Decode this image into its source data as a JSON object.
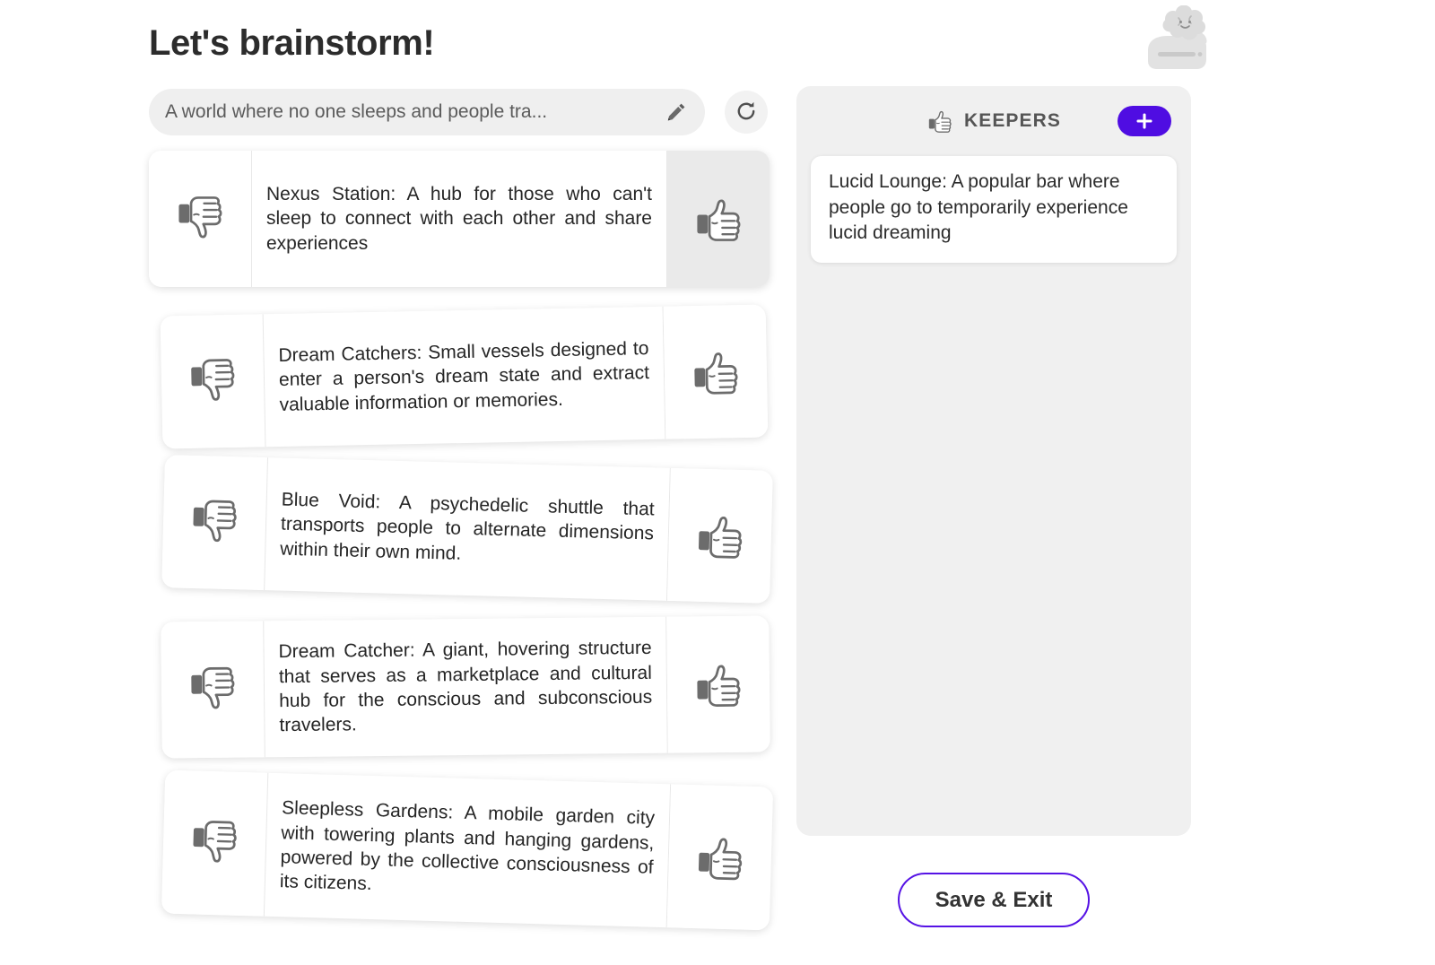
{
  "header": {
    "title": "Let's brainstorm!",
    "logo_icon": "brain-cloud-laptop-logo"
  },
  "prompt": {
    "value": "A world where no one sleeps and people tra...",
    "placeholder": "A world where no one sleeps and people tra...",
    "edit_icon": "pencil-icon",
    "refresh_icon": "refresh-icon"
  },
  "ideas": {
    "downvote_icon": "thumbs-down-icon",
    "upvote_icon": "thumbs-up-icon",
    "items": [
      {
        "text": "Nexus Station: A hub for those who can't sleep to connect with each other and share experiences",
        "upvote_hovered": true
      },
      {
        "text": "Dream Catchers: Small vessels designed to enter a person's dream state and extract valuable information or memories.",
        "upvote_hovered": false
      },
      {
        "text": "Blue Void: A psychedelic shuttle that transports people to alternate dimensions within their own mind.",
        "upvote_hovered": false
      },
      {
        "text": "Dream Catcher: A giant, hovering structure that serves as a marketplace and cultural hub for the conscious and subconscious travelers.",
        "upvote_hovered": false
      },
      {
        "text": "Sleepless Gardens: A mobile garden city with towering plants and hanging gardens, powered by the collective consciousness of its citizens.",
        "upvote_hovered": false
      }
    ]
  },
  "keepers": {
    "title": "KEEPERS",
    "thumb_icon": "thumbs-up-icon",
    "add_label": "+",
    "add_icon": "plus-icon",
    "cards": [
      {
        "text": "Lucid Lounge: A popular bar where people go to temporarily experience lucid dreaming"
      }
    ]
  },
  "footer": {
    "save_exit_label": "Save & Exit"
  },
  "colors": {
    "accent_purple": "#4f0de2",
    "save_border": "#5613e5",
    "panel_gray": "#f0f0f0",
    "input_gray": "#efefef",
    "hover_gray": "#eaeaea"
  }
}
